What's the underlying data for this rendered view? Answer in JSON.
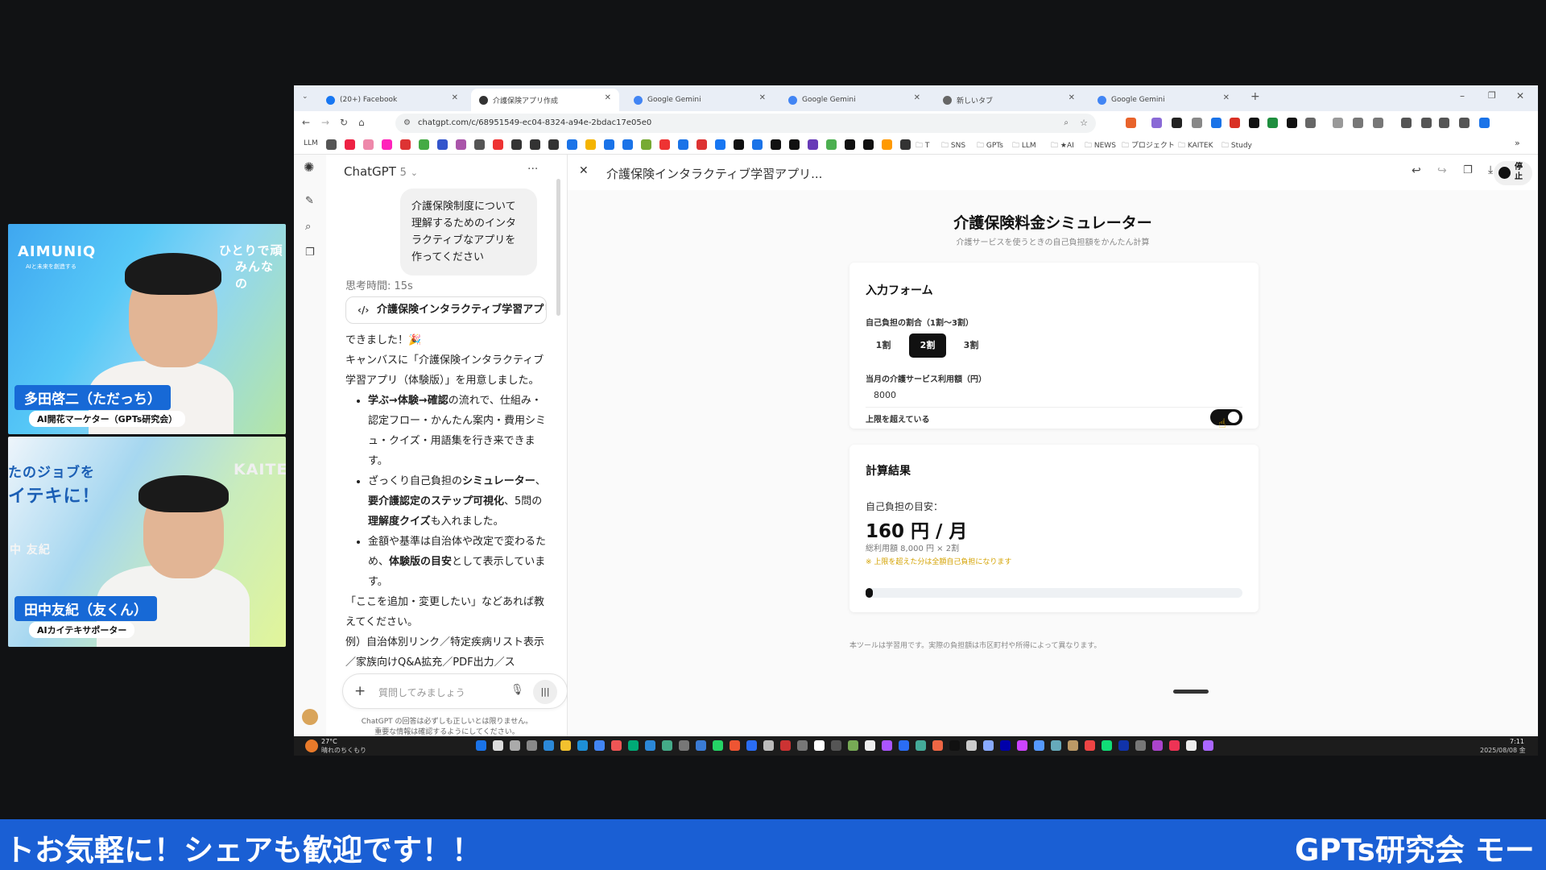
{
  "browser": {
    "tabs": [
      {
        "label": "(20+) Facebook",
        "color": "#1877f2"
      },
      {
        "label": "介護保険アプリ作成",
        "color": "#333333",
        "active": true
      },
      {
        "label": "Google Gemini",
        "color": "#4285f4"
      },
      {
        "label": "Google Gemini",
        "color": "#4285f4"
      },
      {
        "label": "新しいタブ",
        "color": "#666666"
      },
      {
        "label": "Google Gemini",
        "color": "#4285f4"
      }
    ],
    "url": "chatgpt.com/c/68951549-ec04-8324-a94e-2bdac17e05e0",
    "bookmarks_left": "LLM",
    "bookmark_folders": [
      "T",
      "SNS",
      "GPTs",
      "LLM",
      "★AI",
      "NEWS",
      "プロジェクト",
      "KAITEK",
      "Study"
    ]
  },
  "chatgpt": {
    "model": "ChatGPT",
    "model_version": "5",
    "user_message": "介護保険制度について理解するためのインタラクティブなアプリを作ってください",
    "thinking": "思考時間: 15s",
    "canvas_chip": "介護保険インタラクティブ学習アプリ（",
    "reply_intro": "できました！🎉",
    "reply_line2": "キャンバスに「介護保険インタラクティブ学習アプリ（体験版）」を用意しました。",
    "bullet1_bold": "学ぶ→体験→確認",
    "bullet1_rest": "の流れで、仕組み・認定フロー・かんたん案内・費用シミュ・クイズ・用語集を行き来できます。",
    "bullet2_pre": "ざっくり自己負担の",
    "bullet2_b1": "シミュレーター",
    "bullet2_mid": "、",
    "bullet2_b2": "要介護認定のステップ可視化",
    "bullet2_mid2": "、5問の",
    "bullet2_b3": "理解度クイズ",
    "bullet2_end": "も入れました。",
    "bullet3_pre": "金額や基準は自治体や改定で変わるため、",
    "bullet3_bold": "体験版の目安",
    "bullet3_end": "として表示しています。",
    "reply_outro": "「ここを追加・変更したい」などあれば教えてください。",
    "reply_example": "例）自治体別リンク／特定疾病リスト表示／家族向けQ&A拡充／PDF出力／ス",
    "composer_placeholder": "質問してみましょう",
    "disclaimer": "ChatGPT の回答は必ずしも正しいとは限りません。重要な情報は確認するようにしてください。"
  },
  "canvas": {
    "title": "介護保険インタラクティブ学習アプリ...",
    "stop_label": "停止",
    "app_title": "介護保険料金シミュレーター",
    "app_subtitle": "介護サービスを使うときの自己負担額をかんたん計算",
    "form": {
      "heading": "入力フォーム",
      "ratio_label": "自己負担の割合（1割〜3割）",
      "ratio_options": [
        "1割",
        "2割",
        "3割"
      ],
      "ratio_selected": "2割",
      "usage_label": "当月の介護サービス利用額（円）",
      "usage_value": "8000",
      "over_limit_label": "上限を超えている",
      "over_limit_on": true
    },
    "result": {
      "heading": "計算結果",
      "estimate_label": "自己負担の目安：",
      "amount": "160 円 / 月",
      "breakdown": "総利用額 8,000 円 × 2割",
      "note": "※ 上限を超えた分は全額自己負担になります",
      "progress": 0.02
    },
    "footer": "本ツールは学習用です。実際の負担額は市区町村や所得によって異なります。"
  },
  "taskbar": {
    "weather_temp": "27°C",
    "weather_desc": "晴れのちくもり",
    "time": "7:11",
    "date": "2025/08/08 金"
  },
  "stream": {
    "cam1_logo": "AIMUNIQ",
    "cam1_tagline": "AIと未来を創造する",
    "cam1_side": "ひとりで頑",
    "cam1_side2": "みんなの",
    "cam1_name": "多田啓二（ただっち）",
    "cam1_role": "AI開花マーケター（GPTs研究会）",
    "cam2_big1": "たのジョブを",
    "cam2_big2": "イテキに！",
    "cam2_logo": "KAITE",
    "cam2_small": "中 友紀",
    "cam2_name": "田中友紀（友くん）",
    "cam2_role": "AIカイテキサポーター",
    "ticker_left": "トお気軽に！シェアも歓迎です！！",
    "ticker_right": "GPTs研究会 モー"
  }
}
